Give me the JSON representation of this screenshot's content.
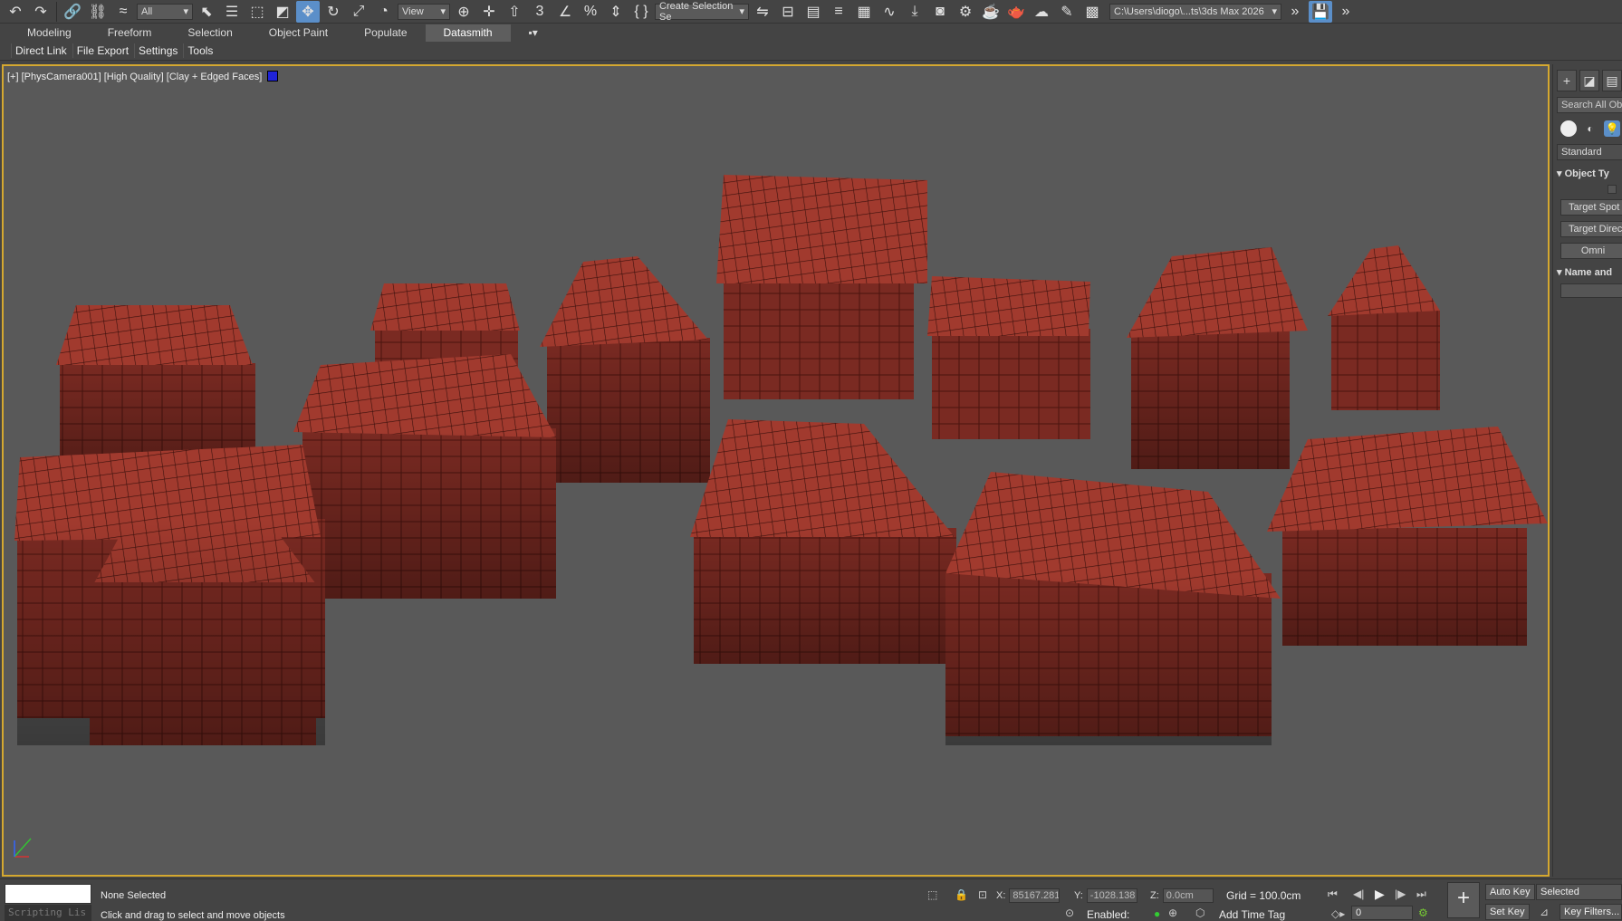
{
  "toolbar": {
    "selection_filter": "All",
    "ref_coord": "View",
    "named_selection": "Create Selection Se",
    "project_path": "C:\\Users\\diogo\\...ts\\3ds Max 2026"
  },
  "ribbon": {
    "tabs": [
      "Modeling",
      "Freeform",
      "Selection",
      "Object Paint",
      "Populate",
      "Datasmith"
    ],
    "active_tab": "Datasmith",
    "buttons": [
      "Direct Link",
      "File Export",
      "Settings",
      "Tools"
    ]
  },
  "viewport": {
    "label": "[+] [PhysCamera001] [High Quality] [Clay + Edged Faces]",
    "border_color": "#d4a830",
    "bg_color": "#595959",
    "model_color": "#8a2d24"
  },
  "command_panel": {
    "search_placeholder": "Search All Obj",
    "category": "Standard",
    "rollout_object_type": "Object Ty",
    "buttons": [
      "Target Spot",
      "Target Direc",
      "Omni"
    ],
    "rollout_name": "Name and"
  },
  "status": {
    "script_listener": "Scripting Lis",
    "selection": "None Selected",
    "prompt": "Click and drag to select and move objects",
    "x_label": "X:",
    "x_value": "85167.281",
    "y_label": "Y:",
    "y_value": "-1028.138",
    "z_label": "Z:",
    "z_value": "0.0cm",
    "grid": "Grid = 100.0cm",
    "enabled_label": "Enabled:",
    "add_time_tag": "Add Time Tag",
    "frame": "0",
    "auto_key": "Auto Key",
    "set_key": "Set Key",
    "selected": "Selected",
    "key_filters": "Key Filters..."
  }
}
